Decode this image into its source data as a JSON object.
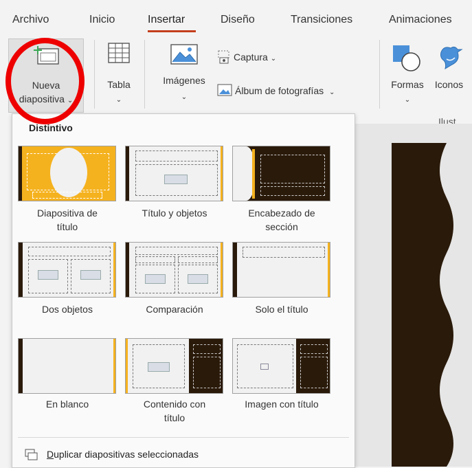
{
  "tabs": [
    "Archivo",
    "Inicio",
    "Insertar",
    "Diseño",
    "Transiciones",
    "Animaciones"
  ],
  "ribbon": {
    "nueva_line1": "Nueva",
    "nueva_line2": "diapositiva",
    "tabla": "Tabla",
    "imagenes": "Imágenes",
    "captura": "Captura",
    "album": "Álbum de fotografías",
    "formas": "Formas",
    "iconos": "Iconos",
    "group_ilust": "Ilust"
  },
  "dropdown": {
    "group_label": "Distintivo",
    "layouts": [
      {
        "line1": "Diapositiva de",
        "line2": "título"
      },
      {
        "line1": "Título y objetos",
        "line2": ""
      },
      {
        "line1": "Encabezado de",
        "line2": "sección"
      },
      {
        "line1": "Dos objetos",
        "line2": ""
      },
      {
        "line1": "Comparación",
        "line2": ""
      },
      {
        "line1": "Solo el título",
        "line2": ""
      },
      {
        "line1": "En blanco",
        "line2": ""
      },
      {
        "line1": "Contenido con",
        "line2": "título"
      },
      {
        "line1": "Imagen con título",
        "line2": ""
      }
    ],
    "duplicate_first": "D",
    "duplicate_rest": "uplicar diapositivas seleccionadas"
  },
  "colors": {
    "accent": "#f5b21f",
    "dark": "#2a1a0a",
    "tab_underline": "#c43e1c",
    "highlight_circle": "#ee0000"
  }
}
